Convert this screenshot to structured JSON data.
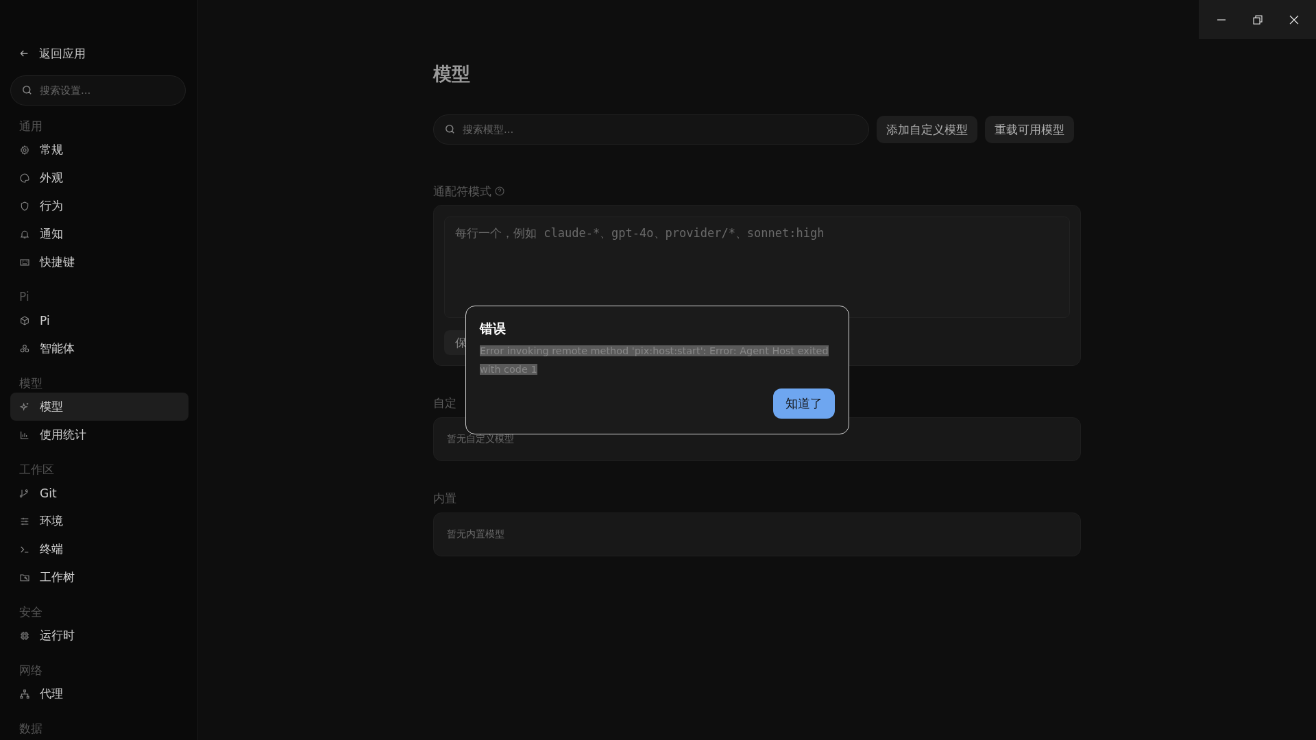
{
  "sidebar": {
    "back_link": "返回应用",
    "search": {
      "placeholder": "搜索设置..."
    },
    "groups": [
      {
        "label": "通用",
        "items": [
          {
            "label": "常规",
            "selected": false
          },
          {
            "label": "外观",
            "selected": false
          },
          {
            "label": "行为",
            "selected": false
          },
          {
            "label": "通知",
            "selected": false
          },
          {
            "label": "快捷键",
            "selected": false
          }
        ]
      },
      {
        "label": "Pi",
        "items": [
          {
            "label": "Pi",
            "selected": false
          },
          {
            "label": "智能体",
            "selected": false
          }
        ]
      },
      {
        "label": "模型",
        "items": [
          {
            "label": "模型",
            "selected": true
          },
          {
            "label": "使用统计",
            "selected": false
          }
        ]
      },
      {
        "label": "工作区",
        "items": [
          {
            "label": "Git",
            "selected": false
          },
          {
            "label": "环境",
            "selected": false
          },
          {
            "label": "终端",
            "selected": false
          },
          {
            "label": "工作树",
            "selected": false
          }
        ]
      },
      {
        "label": "安全",
        "items": [
          {
            "label": "运行时",
            "selected": false
          }
        ]
      },
      {
        "label": "网络",
        "items": [
          {
            "label": "代理",
            "selected": false
          }
        ]
      },
      {
        "label": "数据"
      }
    ]
  },
  "main": {
    "title": "模型",
    "search": {
      "placeholder": "搜索模型..."
    },
    "buttons": [
      "添加自定义模型",
      "重载可用模型"
    ],
    "wildcard": {
      "label": "通配符模式",
      "placeholder": "每行一个，例如 claude-*、gpt-4o、provider/*、sonnet:high",
      "save_button": "保"
    },
    "sections": [
      {
        "label": "自定",
        "empty": "暂无自定义模型"
      },
      {
        "label": "内置",
        "empty": "暂无内置模型"
      }
    ]
  },
  "dialog": {
    "title": "错误",
    "message": "Error invoking remote method 'pix:host:start': Error: Agent Host exited with code 1",
    "button": "知道了"
  }
}
